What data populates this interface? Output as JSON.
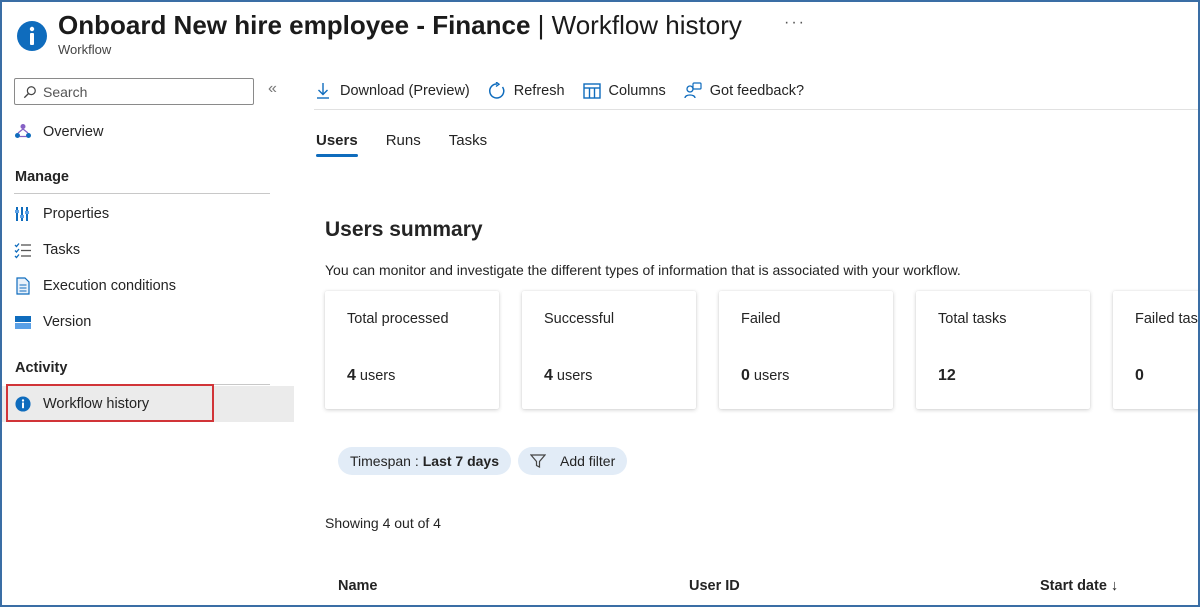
{
  "header": {
    "title": "Onboard New hire employee - Finance",
    "title_suffix": " | Workflow history",
    "subtitle": "Workflow",
    "more": "···"
  },
  "sidebar": {
    "search_placeholder": "Search",
    "collapse": "«",
    "overview": "Overview",
    "manage_label": "Manage",
    "manage_items": [
      "Properties",
      "Tasks",
      "Execution conditions",
      "Version"
    ],
    "activity_label": "Activity",
    "activity_items": [
      "Workflow history"
    ]
  },
  "toolbar": {
    "download": "Download (Preview)",
    "refresh": "Refresh",
    "columns": "Columns",
    "feedback": "Got feedback?"
  },
  "tabs": [
    "Users",
    "Runs",
    "Tasks"
  ],
  "summary": {
    "title": "Users summary",
    "description": "You can monitor and investigate the different types of information that is associated with your workflow.",
    "cards": [
      {
        "label": "Total processed",
        "value": "4",
        "unit": "users"
      },
      {
        "label": "Successful",
        "value": "4",
        "unit": "users"
      },
      {
        "label": "Failed",
        "value": "0",
        "unit": "users"
      },
      {
        "label": "Total tasks",
        "value": "12",
        "unit": ""
      },
      {
        "label": "Failed tasks",
        "value": "0",
        "unit": ""
      }
    ]
  },
  "filters": {
    "timespan_label": "Timespan :",
    "timespan_value": "Last 7 days",
    "add_filter": "Add filter"
  },
  "results": {
    "showing": "Showing 4 out of 4",
    "columns": [
      "Name",
      "User ID",
      "Start date ↓"
    ]
  },
  "colors": {
    "accent": "#0f6cbd",
    "highlight_box": "#d13438",
    "pill_bg": "#e2ecf7"
  }
}
